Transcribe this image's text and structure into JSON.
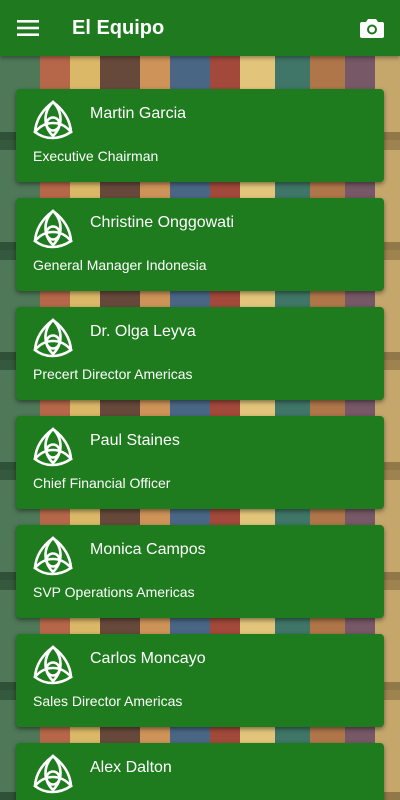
{
  "appbar": {
    "title": "El Equipo",
    "menu_icon": "menu-icon",
    "camera_icon": "camera-icon"
  },
  "colors": {
    "primary": "#1f7a1f",
    "card": "#1e7b1e",
    "text": "#ffffff"
  },
  "team": [
    {
      "name": "Martin Garcia",
      "role": "Executive Chairman"
    },
    {
      "name": "Christine Onggowati",
      "role": "General Manager Indonesia"
    },
    {
      "name": "Dr. Olga Leyva",
      "role": "Precert Director Americas"
    },
    {
      "name": "Paul Staines",
      "role": "Chief Financial Officer"
    },
    {
      "name": "Monica Campos",
      "role": "SVP Operations Americas"
    },
    {
      "name": "Carlos Moncayo",
      "role": "Sales Director Americas"
    },
    {
      "name": "Alex Dalton",
      "role": ""
    }
  ]
}
